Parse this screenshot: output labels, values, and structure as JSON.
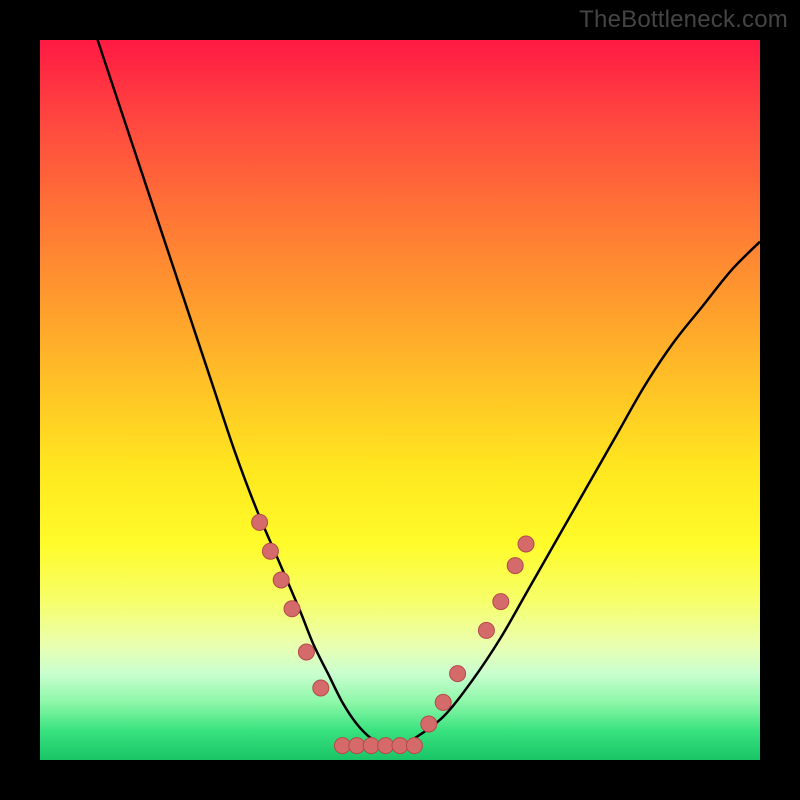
{
  "watermark": "TheBottleneck.com",
  "colors": {
    "frame": "#000000",
    "curve": "#000000",
    "dot_fill": "#d46a6a",
    "dot_stroke": "#b54a4a",
    "gradient_top": "#ff1a44",
    "gradient_bottom": "#18c466"
  },
  "chart_data": {
    "type": "line",
    "title": "",
    "xlabel": "",
    "ylabel": "",
    "xlim": [
      0,
      100
    ],
    "ylim": [
      0,
      100
    ],
    "grid": false,
    "legend": false,
    "annotations": [
      "TheBottleneck.com"
    ],
    "series": [
      {
        "name": "curve",
        "x": [
          8,
          12,
          16,
          20,
          24,
          27,
          30,
          33,
          36,
          38,
          40,
          42,
          44,
          46,
          48,
          50,
          52,
          56,
          60,
          64,
          68,
          72,
          76,
          80,
          84,
          88,
          92,
          96,
          100
        ],
        "y": [
          100,
          88,
          76,
          64,
          52,
          43,
          35,
          28,
          21,
          16,
          12,
          8,
          5,
          3,
          2,
          2,
          3,
          6,
          11,
          17,
          24,
          31,
          38,
          45,
          52,
          58,
          63,
          68,
          72
        ]
      }
    ],
    "dots_flat": {
      "name": "flat-dots",
      "x": [
        42,
        44,
        46,
        48,
        50,
        52
      ],
      "y": [
        2,
        2,
        2,
        2,
        2,
        2
      ]
    },
    "dots_left": {
      "name": "left-branch-dots",
      "x": [
        30.5,
        32,
        33.5,
        35,
        37,
        39
      ],
      "y": [
        33,
        29,
        25,
        21,
        15,
        10
      ]
    },
    "dots_right": {
      "name": "right-branch-dots",
      "x": [
        54,
        56,
        58,
        62,
        64,
        66,
        67.5
      ],
      "y": [
        5,
        8,
        12,
        18,
        22,
        27,
        30
      ]
    }
  }
}
